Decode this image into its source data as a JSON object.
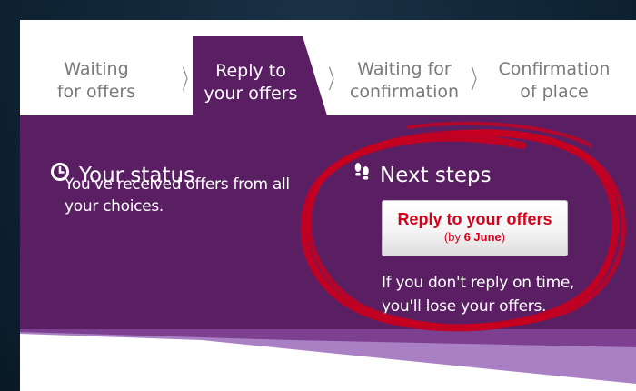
{
  "steps": [
    {
      "line1": "Waiting",
      "line2": "for offers",
      "active": false
    },
    {
      "line1": "Reply to",
      "line2": "your offers",
      "active": true
    },
    {
      "line1": "Waiting for",
      "line2": "confirmation",
      "active": false
    },
    {
      "line1": "Confirmation",
      "line2": "of place",
      "active": false
    }
  ],
  "status": {
    "title": "Your status",
    "line1": "You've received offers from all",
    "line2": "your choices.",
    "icon": "clock-icon"
  },
  "next_steps": {
    "title": "Next steps",
    "icon": "footprints-icon",
    "button_label": "Reply to your offers",
    "deadline_prefix": "(by ",
    "deadline_date": "6 June",
    "deadline_suffix": ")",
    "warning_line1": "If you don't reply on time,",
    "warning_line2": "you'll lose your offers."
  },
  "colors": {
    "purple": "#5a1f63",
    "purple_light": "#9b62b3",
    "button_text": "#d6001c",
    "annotation_red": "#c8001e"
  }
}
